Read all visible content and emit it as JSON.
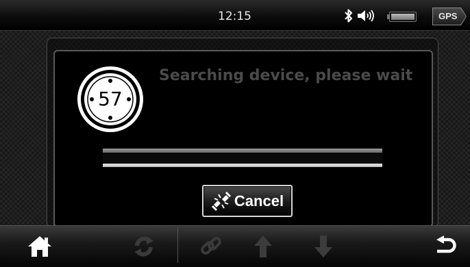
{
  "status_bar": {
    "time": "12:15",
    "gps_label": "GPS",
    "icons": [
      "bluetooth-icon",
      "speaker-volume-icon",
      "battery-icon"
    ]
  },
  "dialog": {
    "satellite_count": "57",
    "message": "Searching device, please wait",
    "progress": 0,
    "cancel_label": "Cancel",
    "cancel_icon": "broken-link-icon"
  },
  "toolbar": {
    "buttons": [
      {
        "icon": "home-icon",
        "enabled": true
      },
      {
        "icon": "refresh-icon",
        "enabled": false
      },
      {
        "icon": "link-icon",
        "enabled": false
      },
      {
        "icon": "arrow-up-icon",
        "enabled": false
      },
      {
        "icon": "arrow-down-icon",
        "enabled": false
      },
      {
        "icon": "back-icon",
        "enabled": true
      }
    ]
  },
  "colors": {
    "message_text": "#4a4a4a",
    "disabled_icon": "#3c3c3c",
    "enabled_icon": "#ffffff"
  }
}
